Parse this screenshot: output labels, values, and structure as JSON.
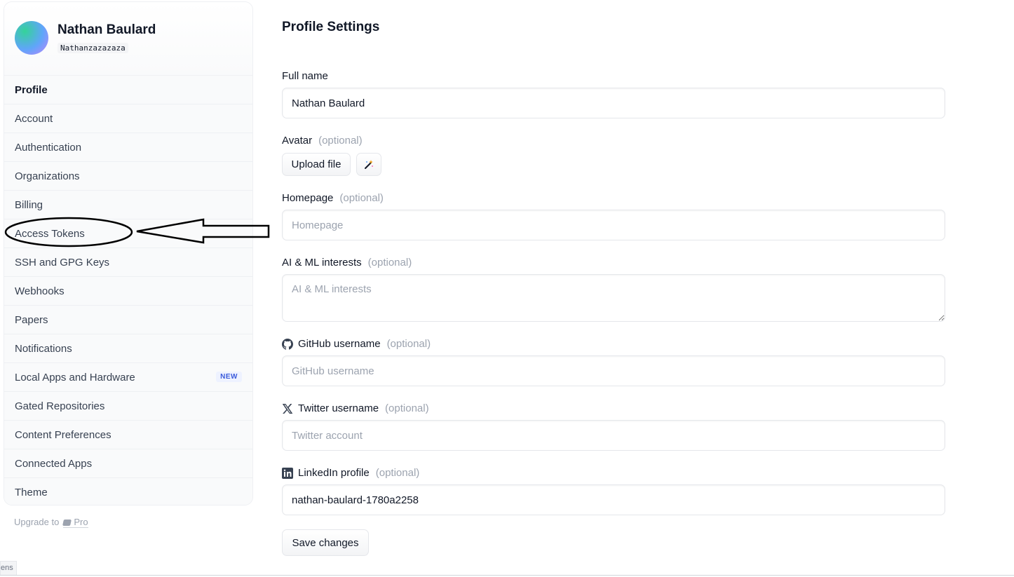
{
  "user": {
    "name": "Nathan Baulard",
    "handle": "Nathanzazazaza"
  },
  "sidebar": {
    "items": [
      {
        "label": "Profile",
        "active": true
      },
      {
        "label": "Account"
      },
      {
        "label": "Authentication"
      },
      {
        "label": "Organizations"
      },
      {
        "label": "Billing"
      },
      {
        "label": "Access Tokens",
        "annotated": true
      },
      {
        "label": "SSH and GPG Keys"
      },
      {
        "label": "Webhooks"
      },
      {
        "label": "Papers"
      },
      {
        "label": "Notifications"
      },
      {
        "label": "Local Apps and Hardware",
        "badge": "NEW"
      },
      {
        "label": "Gated Repositories"
      },
      {
        "label": "Content Preferences"
      },
      {
        "label": "Connected Apps"
      },
      {
        "label": "Theme"
      }
    ],
    "upgrade_text": "Upgrade to",
    "upgrade_pro": "Pro"
  },
  "main": {
    "title": "Profile Settings",
    "optional_text": "(optional)",
    "full_name": {
      "label": "Full name",
      "value": "Nathan Baulard"
    },
    "avatar": {
      "label": "Avatar",
      "upload_label": "Upload file",
      "magic_icon": "magic-wand-icon"
    },
    "homepage": {
      "label": "Homepage",
      "placeholder": "Homepage",
      "value": ""
    },
    "interests": {
      "label": "AI & ML interests",
      "placeholder": "AI & ML interests",
      "value": ""
    },
    "github": {
      "label": "GitHub username",
      "placeholder": "GitHub username",
      "value": "",
      "icon": "github-icon"
    },
    "twitter": {
      "label": "Twitter username",
      "placeholder": "Twitter account",
      "value": "",
      "icon": "x-icon"
    },
    "linkedin": {
      "label": "LinkedIn profile",
      "placeholder": "",
      "value": "nathan-baulard-1780a2258",
      "icon": "linkedin-icon"
    },
    "save_label": "Save changes"
  },
  "status_tooltip": "ens",
  "colors": {
    "badge": "#3b5bdb",
    "muted": "#9ca3af",
    "text": "#111827"
  }
}
